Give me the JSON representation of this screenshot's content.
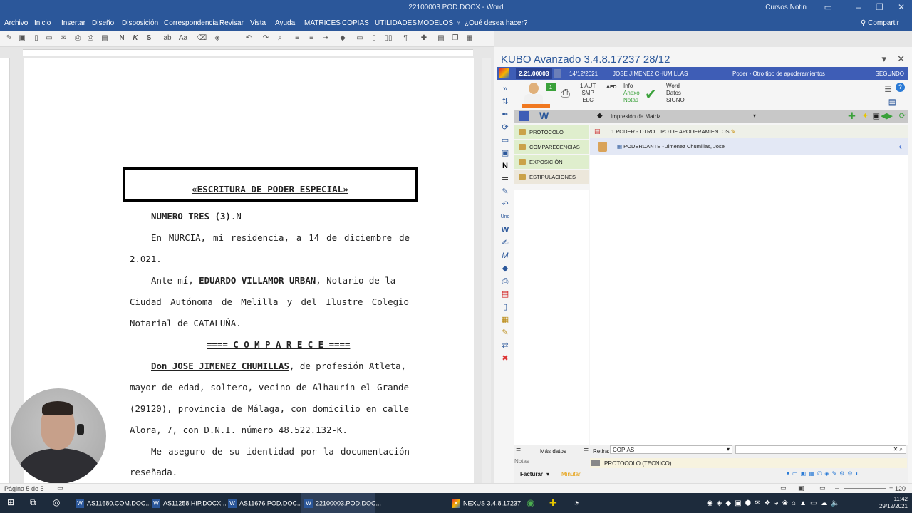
{
  "titlebar": {
    "title": "22100003.POD.DOCX - Word",
    "user": "Cursos Notin"
  },
  "ribbon": {
    "tabs": [
      "Archivo",
      "Inicio",
      "Insertar",
      "Diseño",
      "Disposición",
      "Correspondencia",
      "Revisar",
      "Vista",
      "Ayuda",
      "MATRICES",
      "COPIAS",
      "UTILIDADES",
      "MODELOS"
    ],
    "tell_me": "¿Qué desea hacer?",
    "share": "Compartir"
  },
  "document": {
    "title_box": "«ESCRITURA DE PODER ESPECIAL»",
    "lines": {
      "l1a": "NUMERO TRES (3)",
      "l1b": ".N",
      "l2": [
        "En",
        "MURCIA,",
        "mi",
        "residencia,",
        "a",
        "14",
        "de",
        "diciembre",
        "de"
      ],
      "l3": "2.021.",
      "l4a": "Ante mí,",
      "l4b": "EDUARDO VILLAMOR URBAN",
      "l4c": ", Notario de la",
      "l5": [
        "Ciudad",
        "Autónoma",
        "de",
        "Melilla",
        "y",
        "del",
        "Ilustre",
        "Colegio"
      ],
      "l6": "Notarial de CATALUÑA.",
      "l7": "==== C O M P A R E C E ====",
      "l8a": "Don JOSE JIMENEZ CHUMILLAS",
      "l8b": ", de profesión Atleta,",
      "l9": [
        "mayor",
        "de",
        "edad,",
        "soltero,",
        "vecino",
        "de",
        "Alhaurín",
        "el",
        "Grande"
      ],
      "l10": [
        "(29120),",
        "provincia",
        "de",
        "Málaga,",
        "con",
        "domicilio",
        "en",
        "calle"
      ],
      "l11": "Alora, 7, con D.N.I. número 48.522.132-K.",
      "l12": [
        "Me",
        "aseguro",
        "de",
        "su",
        "identidad",
        "por",
        "la",
        "documentación"
      ],
      "l13": "reseñada."
    }
  },
  "statusbar": {
    "page": "Página 5 de 5",
    "zoom": "120 %"
  },
  "kubo": {
    "title": "KUBO Avanzado 3.4.8.17237   28/12",
    "ref": "2.21.00003",
    "date": "14/12/2021",
    "client": "JOSE JIMENEZ CHUMILLAS",
    "act": "Poder - Otro tipo de apoderamientos",
    "status": "SEGUNDO",
    "badge": "1",
    "aut": "1 AUT",
    "smp": "SMP",
    "elc": "ELC",
    "afd": "AFD",
    "info": "Info",
    "anexo": "Anexo",
    "notas": "Notas",
    "word": "Word",
    "datos": "Datos",
    "signo": "SIGNO",
    "combo": "Impresión de Matriz",
    "tree": [
      "PROTOCOLO",
      "COMPARECENCIAS",
      "EXPOSICIÓN",
      "ESTIPULACIONES"
    ],
    "row1": "1 PODER - OTRO TIPO DE APODERAMIENTOS",
    "row2": "PODERDANTE - Jimenez Chumillas, Jose",
    "mas_datos": "Más datos",
    "notas_label": "Notas",
    "retira_label": "Retira:",
    "retira_value": "COPIAS",
    "protocolo_tecnico": "PROTOCOLO (TECNICO)",
    "facturar": "Facturar",
    "minutar": "Minutar"
  },
  "taskbar": {
    "items": [
      "AS11680.COM.DOC...",
      "AS11258.HIP.DOCX...",
      "AS11676.POD.DOC...",
      "22100003.POD.DOC...",
      "NEXUS  3.4.8.17237"
    ],
    "time": "11:42",
    "date": "29/12/2021"
  }
}
